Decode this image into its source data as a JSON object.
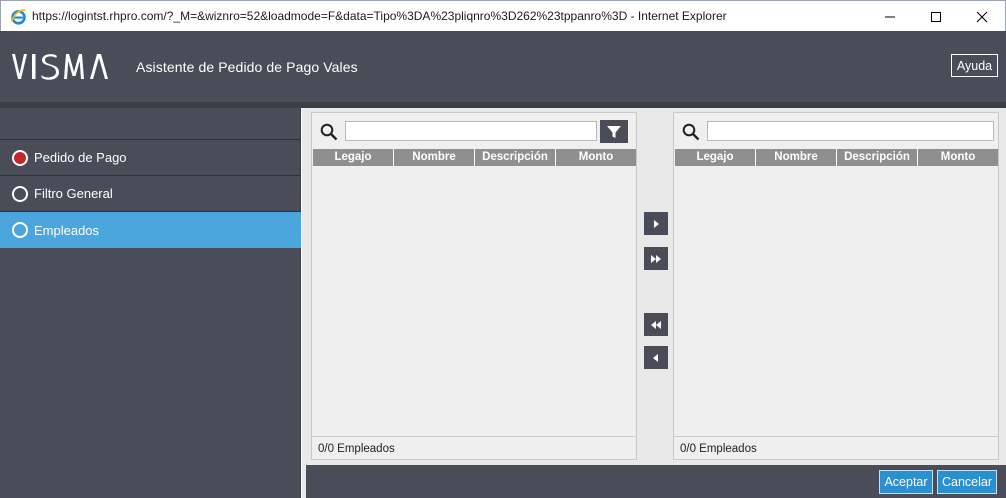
{
  "window": {
    "title": "https://logintst.rhpro.com/?_M=&wiznro=52&loadmode=F&data=Tipo%3DA%23pliqnro%3D262%23tppanro%3D - Internet Explorer",
    "browser_icon": "internet-explorer-icon",
    "controls": [
      "minimize-icon",
      "maximize-icon",
      "close-icon"
    ]
  },
  "header": {
    "logo_text": "VISMA",
    "title": "Asistente de Pedido de Pago Vales",
    "help_label": "Ayuda"
  },
  "sidebar": {
    "items": [
      {
        "label": "Pedido de Pago",
        "state": "completed",
        "icon": "radio-filled-red"
      },
      {
        "label": "Filtro General",
        "state": "pending",
        "icon": "radio-empty"
      },
      {
        "label": "Empleados",
        "state": "active",
        "icon": "radio-empty"
      }
    ]
  },
  "left_panel": {
    "search_value": "",
    "search_icon": "search-icon",
    "filter_icon": "filter-icon",
    "columns": [
      "Legajo",
      "Nombre",
      "Descripción",
      "Monto"
    ],
    "rows": [],
    "footer": "0/0 Empleados"
  },
  "transfer_buttons": [
    {
      "name": "move-selected-right",
      "icon": "triangle-right-icon"
    },
    {
      "name": "move-all-right",
      "icon": "double-triangle-right-icon"
    },
    {
      "name": "move-all-left",
      "icon": "double-triangle-left-icon"
    },
    {
      "name": "move-selected-left",
      "icon": "triangle-left-icon"
    }
  ],
  "right_panel": {
    "search_value": "",
    "search_icon": "search-icon",
    "columns": [
      "Legajo",
      "Nombre",
      "Descripción",
      "Monto"
    ],
    "rows": [],
    "footer": "0/0 Empleados"
  },
  "footer": {
    "accept_label": "Aceptar",
    "cancel_label": "Cancelar"
  },
  "colors": {
    "header_bg": "#4a4d57",
    "active_step": "#4aa6dc",
    "completed_step": "#c0272d",
    "primary_button": "#2b8fd0"
  }
}
